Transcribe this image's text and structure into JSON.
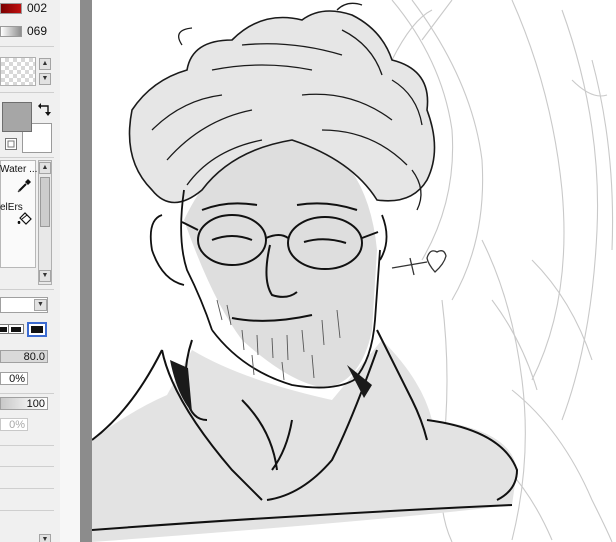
{
  "panel": {
    "slider_1_value": "002",
    "slider_2_value": "069",
    "brush_tool_1_label": "Water ...",
    "brush_tool_2_label": "elErs",
    "brush_density_value": "80.0",
    "min_size_value": "0%",
    "opacity_value": "100",
    "disabled_value": "0%"
  },
  "colors": {
    "primary": "#a6a6a6",
    "slider_red": "#c01010",
    "canvas_border": "#8c8c8c"
  },
  "icons": [
    "swap-arrows-icon",
    "eyedropper-icon",
    "paint-bucket-icon",
    "scroll-up-icon",
    "scroll-down-icon",
    "dropdown-arrow-icon"
  ]
}
